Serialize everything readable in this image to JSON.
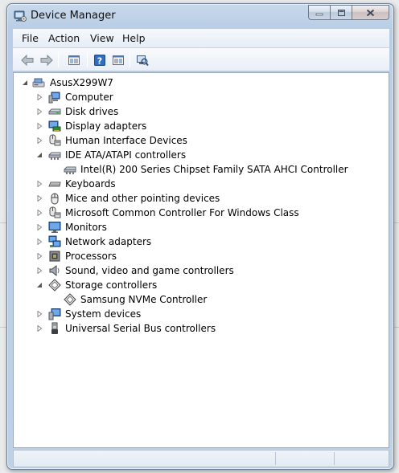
{
  "window": {
    "title": "Device Manager",
    "icon": "device-manager-icon"
  },
  "caption_buttons": {
    "minimize": "minimize-icon",
    "maximize": "maximize-icon",
    "close": "close-icon"
  },
  "menu": {
    "items": [
      "File",
      "Action",
      "View",
      "Help"
    ]
  },
  "toolbar": {
    "buttons": [
      "back-arrow-icon",
      "forward-arrow-icon",
      "properties-icon",
      "help-icon",
      "console-tree-icon",
      "scan-hardware-icon"
    ]
  },
  "tree": {
    "root": {
      "label": "AsusX299W7",
      "icon": "computer-root-icon",
      "expanded": true
    },
    "nodes": [
      {
        "label": "Computer",
        "icon": "computer-icon",
        "level": 1,
        "expanded": false
      },
      {
        "label": "Disk drives",
        "icon": "disk-drive-icon",
        "level": 1,
        "expanded": false
      },
      {
        "label": "Display adapters",
        "icon": "display-adapter-icon",
        "level": 1,
        "expanded": false
      },
      {
        "label": "Human Interface Devices",
        "icon": "hid-icon",
        "level": 1,
        "expanded": false
      },
      {
        "label": "IDE ATA/ATAPI controllers",
        "icon": "ide-controller-icon",
        "level": 1,
        "expanded": true
      },
      {
        "label": "Intel(R) 200 Series Chipset Family SATA AHCI Controller",
        "icon": "sata-controller-icon",
        "level": 2
      },
      {
        "label": "Keyboards",
        "icon": "keyboard-icon",
        "level": 1,
        "expanded": false
      },
      {
        "label": "Mice and other pointing devices",
        "icon": "mouse-icon",
        "level": 1,
        "expanded": false
      },
      {
        "label": "Microsoft Common Controller For Windows Class",
        "icon": "common-controller-icon",
        "level": 1,
        "expanded": false
      },
      {
        "label": "Monitors",
        "icon": "monitor-icon",
        "level": 1,
        "expanded": false
      },
      {
        "label": "Network adapters",
        "icon": "network-adapter-icon",
        "level": 1,
        "expanded": false
      },
      {
        "label": "Processors",
        "icon": "processor-icon",
        "level": 1,
        "expanded": false
      },
      {
        "label": "Sound, video and game controllers",
        "icon": "sound-icon",
        "level": 1,
        "expanded": false
      },
      {
        "label": "Storage controllers",
        "icon": "storage-controller-icon",
        "level": 1,
        "expanded": true
      },
      {
        "label": "Samsung NVMe Controller",
        "icon": "storage-device-icon",
        "level": 2
      },
      {
        "label": "System devices",
        "icon": "system-devices-icon",
        "level": 1,
        "expanded": false
      },
      {
        "label": "Universal Serial Bus controllers",
        "icon": "usb-icon",
        "level": 1,
        "expanded": false
      }
    ]
  },
  "statusbar": {
    "text": ""
  }
}
